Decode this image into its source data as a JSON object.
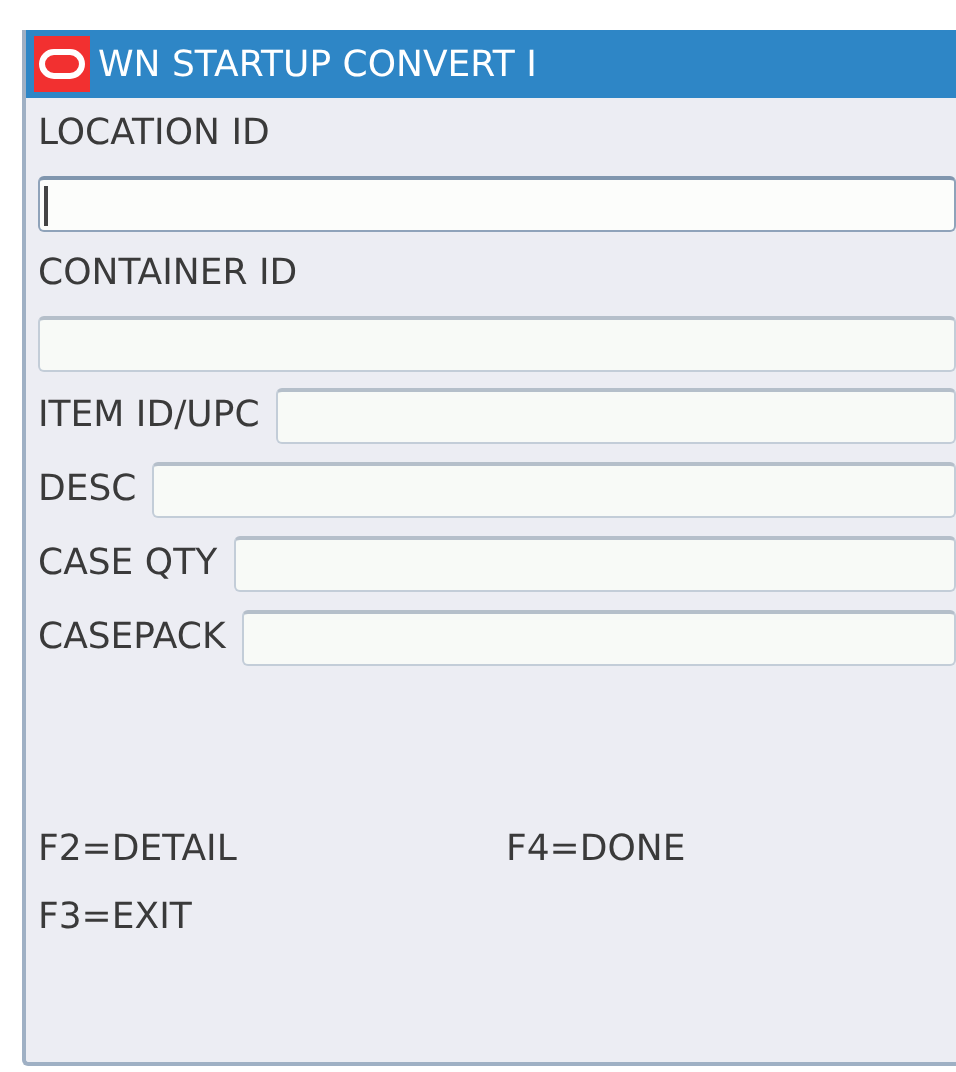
{
  "window": {
    "title": "WN STARTUP CONVERT I"
  },
  "fields": [
    {
      "kind": "stacked",
      "label": "LOCATION ID",
      "focused": true
    },
    {
      "kind": "stacked",
      "label": "CONTAINER ID",
      "focused": false
    },
    {
      "kind": "inline",
      "label": "ITEM ID/UPC",
      "focused": false
    },
    {
      "kind": "inline",
      "label": "DESC",
      "focused": false
    },
    {
      "kind": "inline",
      "label": "CASE QTY",
      "focused": false
    },
    {
      "kind": "inline",
      "label": "CASEPACK",
      "focused": false
    }
  ],
  "keys": [
    [
      "F2=DETAIL",
      "F4=DONE"
    ],
    [
      "F3=EXIT"
    ]
  ]
}
